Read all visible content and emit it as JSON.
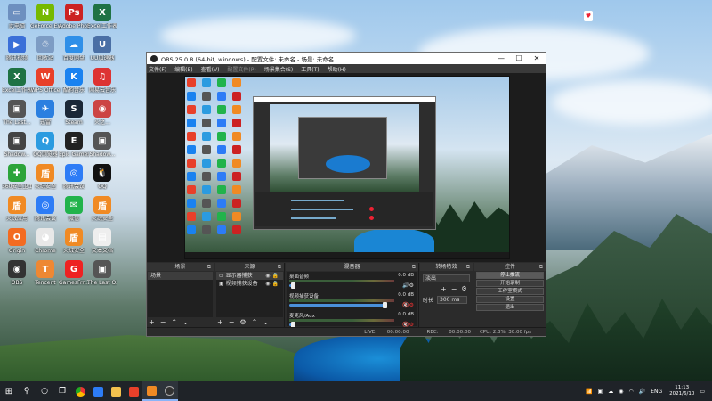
{
  "desktop": {
    "icons": [
      {
        "label": "此电脑",
        "color": "#6d8fbf",
        "glyph": "▭"
      },
      {
        "label": "GeForce Experience",
        "color": "#76b900",
        "glyph": "N"
      },
      {
        "label": "Adobe Photoshop",
        "color": "#cc2222",
        "glyph": "Ps"
      },
      {
        "label": "Excel工作表",
        "color": "#1f7244",
        "glyph": "X"
      },
      {
        "label": "腾讯视频",
        "color": "#3a6fd8",
        "glyph": "▶"
      },
      {
        "label": "回收站",
        "color": "#7d9cc4",
        "glyph": "♲"
      },
      {
        "label": "百度网盘",
        "color": "#2f8fe8",
        "glyph": "☁"
      },
      {
        "label": "UU加速器",
        "color": "#4a6fa5",
        "glyph": "U"
      },
      {
        "label": "Excel工作表",
        "color": "#1f7244",
        "glyph": "X"
      },
      {
        "label": "WPS Office",
        "color": "#e8402a",
        "glyph": "W"
      },
      {
        "label": "酷狗音乐",
        "color": "#1a82f0",
        "glyph": "K"
      },
      {
        "label": "网易云音乐",
        "color": "#d33",
        "glyph": "♫"
      },
      {
        "label": "The Last...",
        "color": "#555",
        "glyph": "▣"
      },
      {
        "label": "迅雷",
        "color": "#2b7fe0",
        "glyph": "✈"
      },
      {
        "label": "Steam",
        "color": "#1b2838",
        "glyph": "S"
      },
      {
        "label": "火之...",
        "color": "#c44",
        "glyph": "◉"
      },
      {
        "label": "Shadow...",
        "color": "#444",
        "glyph": "▣"
      },
      {
        "label": "QQ浏览器",
        "color": "#2b9be0",
        "glyph": "Q"
      },
      {
        "label": "Epic Games Launcher",
        "color": "#222",
        "glyph": "E"
      },
      {
        "label": "Shadow...",
        "color": "#555",
        "glyph": "▣"
      },
      {
        "label": "360安全卫士",
        "color": "#2ca43a",
        "glyph": "✚"
      },
      {
        "label": "火绒安全",
        "color": "#f08a24",
        "glyph": "盾"
      },
      {
        "label": "腾讯会议",
        "color": "#2d7cf6",
        "glyph": "◎"
      },
      {
        "label": "QQ",
        "color": "#111",
        "glyph": "🐧"
      },
      {
        "label": "火绒应用",
        "color": "#f08a24",
        "glyph": "盾"
      },
      {
        "label": "腾讯会议",
        "color": "#2d7cf6",
        "glyph": "◎"
      },
      {
        "label": "微信",
        "color": "#21b34b",
        "glyph": "✉"
      },
      {
        "label": "火绒安全",
        "color": "#f08a24",
        "glyph": "盾"
      },
      {
        "label": "Origin",
        "color": "#f36b21",
        "glyph": "O"
      },
      {
        "label": "Chrome",
        "color": "#e8e8e8",
        "glyph": "◕"
      },
      {
        "label": "火绒安全",
        "color": "#f08a24",
        "glyph": "盾"
      },
      {
        "label": "文本文档",
        "color": "#eee",
        "glyph": "▤"
      },
      {
        "label": "OBS",
        "color": "#333",
        "glyph": "◉"
      },
      {
        "label": "Tencent",
        "color": "#e83",
        "glyph": "T"
      },
      {
        "label": "GamesFrn...",
        "color": "#e22",
        "glyph": "G"
      },
      {
        "label": "The Last O...",
        "color": "#555",
        "glyph": "▣"
      }
    ]
  },
  "obs": {
    "title": "OBS 25.0.8 (64-bit, windows) - 配置文件: 未命名 - 场景: 未命名",
    "window_buttons": [
      "—",
      "☐",
      "✕"
    ],
    "menu": [
      "文件(F)",
      "编辑(E)",
      "查看(V)",
      "配置文件(P)",
      "场景集合(S)",
      "工具(T)",
      "帮助(H)"
    ],
    "docks": {
      "scenes": {
        "title": "场景",
        "items": [
          "场景"
        ]
      },
      "sources": {
        "title": "来源",
        "items": [
          "显示器捕获",
          "视频捕获设备"
        ]
      },
      "mixer": {
        "title": "混音器",
        "channels": [
          {
            "name": "桌面音频",
            "db": "0.0 dB",
            "level": 0.0,
            "muted": false
          },
          {
            "name": "视频捕获设备",
            "db": "0.0 dB",
            "level": 0.92,
            "muted": true
          },
          {
            "name": "麦克风/Aux",
            "db": "0.0 dB",
            "level": 0.0,
            "muted": true
          }
        ]
      },
      "transitions": {
        "title": "转场特效",
        "selected": "淡出",
        "duration_label": "时长",
        "duration_value": "300 ms"
      },
      "controls": {
        "title": "控件",
        "buttons": [
          "停止推流",
          "开始录制",
          "工作室模式",
          "设置",
          "退出"
        ]
      }
    },
    "status": {
      "live_label": "LIVE:",
      "live_time": "00:00:00",
      "rec_label": "REC:",
      "rec_time": "00:00:00",
      "cpu": "CPU: 2.3%, 30.00 fps"
    }
  },
  "taskbar": {
    "lang": "ENG",
    "time": "11:13",
    "date": "2021/6/10"
  }
}
